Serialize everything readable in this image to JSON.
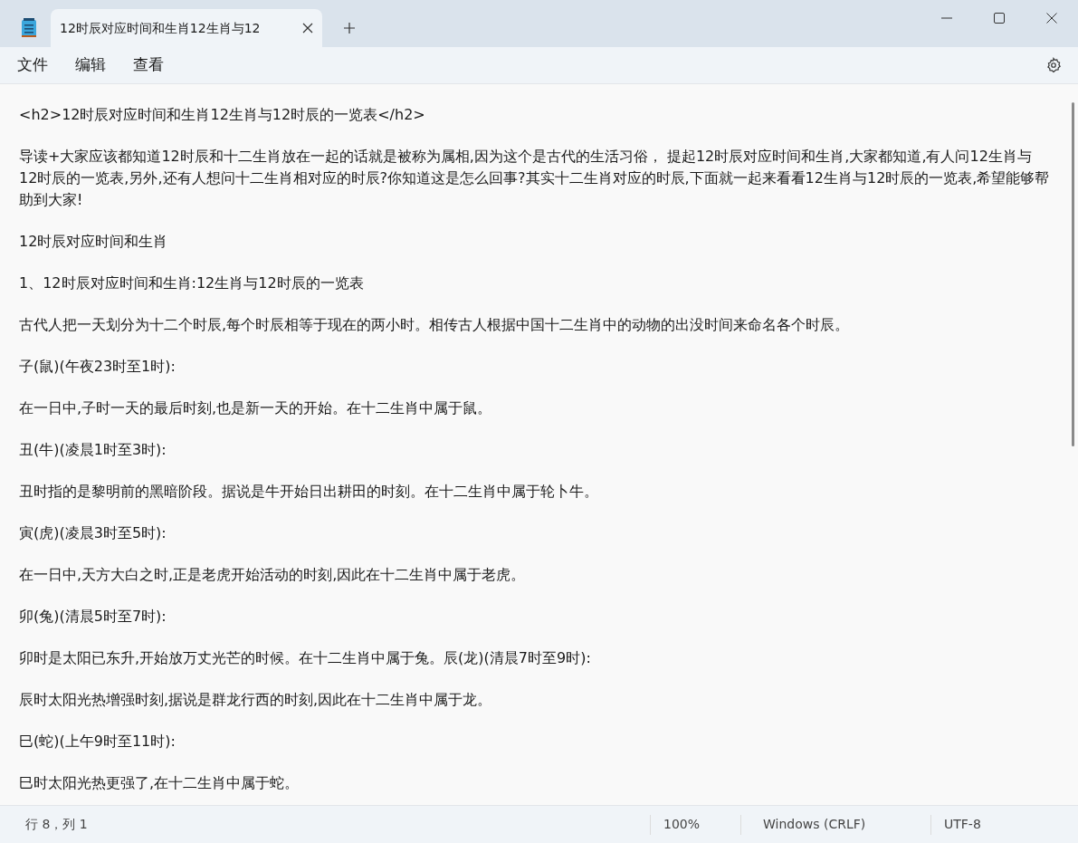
{
  "tabs": [
    {
      "title": "12时辰对应时间和生肖12生肖与12",
      "selected": true
    }
  ],
  "menu": [
    "文件",
    "编辑",
    "查看"
  ],
  "document": {
    "paragraphs": [
      "<h2>12时辰对应时间和生肖12生肖与12时辰的一览表</h2>",
      "导读+大家应该都知道12时辰和十二生肖放在一起的话就是被称为属相,因为这个是古代的生活习俗， 提起12时辰对应时间和生肖,大家都知道,有人问12生肖与12时辰的一览表,另外,还有人想问十二生肖相对应的时辰?你知道这是怎么回事?其实十二生肖对应的时辰,下面就一起来看看12生肖与12时辰的一览表,希望能够帮助到大家!",
      "12时辰对应时间和生肖",
      "1、12时辰对应时间和生肖:12生肖与12时辰的一览表",
      "古代人把一天划分为十二个时辰,每个时辰相等于现在的两小时。相传古人根据中国十二生肖中的动物的出没时间来命名各个时辰。",
      "子(鼠)(午夜23时至1时):",
      "在一日中,子时一天的最后时刻,也是新一天的开始。在十二生肖中属于鼠。",
      "丑(牛)(凌晨1时至3时):",
      "丑时指的是黎明前的黑暗阶段。据说是牛开始日出耕田的时刻。在十二生肖中属于轮卜牛。",
      "寅(虎)(凌晨3时至5时):",
      "在一日中,天方大白之时,正是老虎开始活动的时刻,因此在十二生肖中属于老虎。",
      "卯(兔)(清晨5时至7时):",
      "卯时是太阳已东升,开始放万丈光芒的时候。在十二生肖中属于兔。辰(龙)(清晨7时至9时):",
      "辰时太阳光热增强时刻,据说是群龙行西的时刻,因此在十二生肖中属于龙。",
      "巳(蛇)(上午9时至11时):",
      "巳时太阳光热更强了,在十二生肖中属于蛇。"
    ]
  },
  "status_bar": [
    "行 8，列 1",
    "100%",
    "Windows (CRLF)",
    "UTF-8"
  ]
}
